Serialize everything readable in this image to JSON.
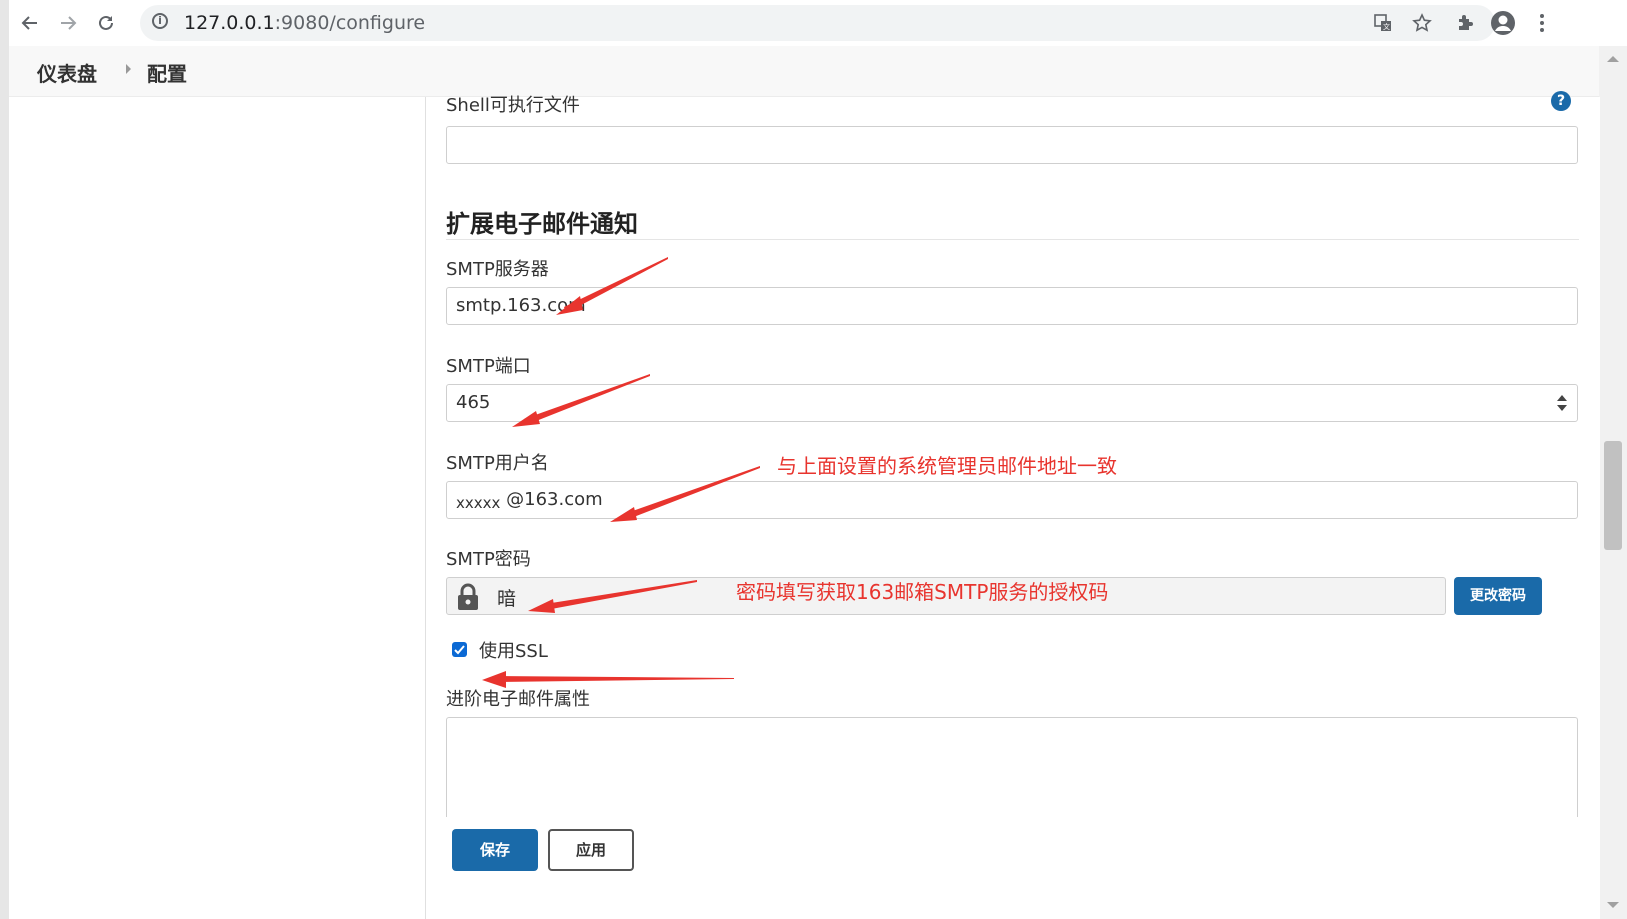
{
  "browser": {
    "url_host": "127.0.0.1",
    "url_rest": ":9080/configure"
  },
  "breadcrumb": {
    "items": [
      "仪表盘",
      "配置"
    ]
  },
  "form": {
    "shell_label": "Shell可执行文件",
    "shell_value": "",
    "section_title": "扩展电子邮件通知",
    "smtp_server_label": "SMTP服务器",
    "smtp_server_value": "smtp.163.com",
    "smtp_port_label": "SMTP端口",
    "smtp_port_value": "465",
    "smtp_user_label": "SMTP用户名",
    "smtp_user_prefix": "xxxxx",
    "smtp_user_suffix": " @163.com",
    "smtp_password_label": "SMTP密码",
    "smtp_password_value": "暗",
    "change_password_label": "更改密码",
    "use_ssl_label": "使用SSL",
    "use_ssl_checked": true,
    "advanced_label": "进阶电子邮件属性",
    "save_label": "保存",
    "apply_label": "应用"
  },
  "annotations": {
    "note_username": "与上面设置的系统管理员邮件地址一致",
    "note_password": "密码填写获取163邮箱SMTP服务的授权码"
  },
  "colors": {
    "accent": "#1a6aa9",
    "annotation": "#e8342e"
  }
}
